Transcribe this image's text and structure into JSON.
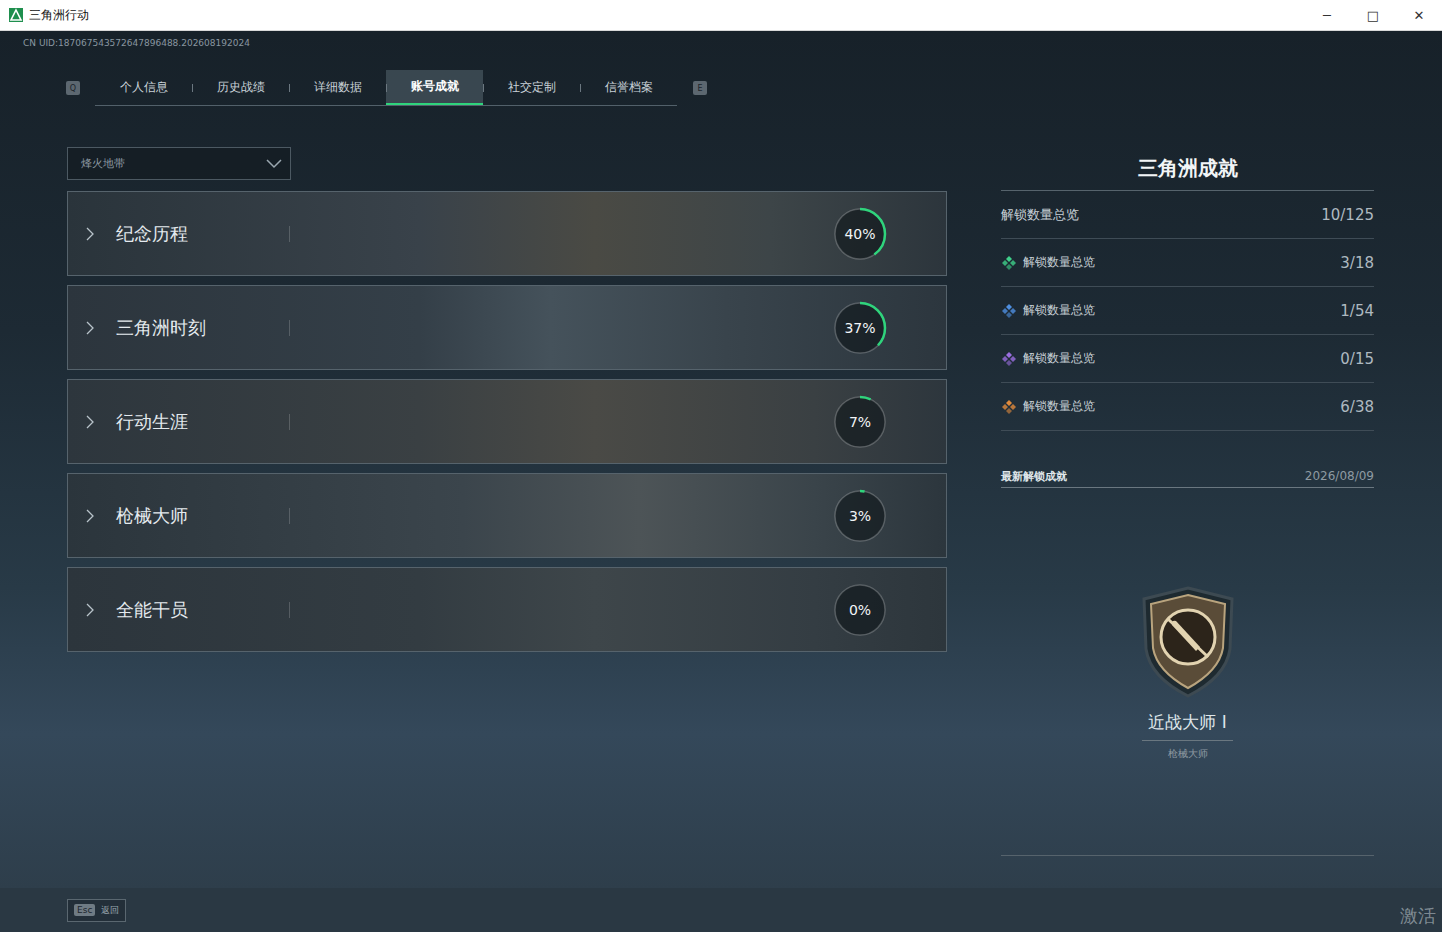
{
  "window": {
    "title": "三角洲行动",
    "controls": [
      "─",
      "□",
      "✕"
    ]
  },
  "uid": "CN UID:187067543572647896488.202608192024",
  "tab_keys": {
    "prev": "Q",
    "next": "E"
  },
  "tabs": [
    {
      "label": "个人信息",
      "selected": false
    },
    {
      "label": "历史战绩",
      "selected": false
    },
    {
      "label": "详细数据",
      "selected": false
    },
    {
      "label": "账号成就",
      "selected": true
    },
    {
      "label": "社交定制",
      "selected": false
    },
    {
      "label": "信誉档案",
      "selected": false
    }
  ],
  "mode_select": {
    "value": "烽火地带"
  },
  "categories": [
    {
      "title": "纪念历程",
      "percent": "40%",
      "level": 0.4
    },
    {
      "title": "三角洲时刻",
      "percent": "37%",
      "level": 0.37
    },
    {
      "title": "行动生涯",
      "percent": "7%",
      "level": 0.07
    },
    {
      "title": "枪械大师",
      "percent": "3%",
      "level": 0.03
    },
    {
      "title": "全能干员",
      "percent": "0%",
      "level": 0
    }
  ],
  "panel": {
    "title": "三角洲成就",
    "summary": {
      "label": "解锁数量总览",
      "count": "10/125"
    },
    "tiers": [
      {
        "label": "解锁数量总览",
        "count": "3/18",
        "color": "#3fd08a"
      },
      {
        "label": "解锁数量总览",
        "count": "1/54",
        "color": "#4f8fe0"
      },
      {
        "label": "解锁数量总览",
        "count": "0/15",
        "color": "#9a6ee0"
      },
      {
        "label": "解锁数量总览",
        "count": "6/38",
        "color": "#e08a3c"
      }
    ],
    "latest": {
      "label": "最新解锁成就",
      "date": "2026/08/09",
      "name": "近战大师 Ⅰ",
      "category": "枪械大师"
    }
  },
  "bottom": {
    "key": "Esc",
    "label": "返回"
  },
  "watermark": "激活"
}
